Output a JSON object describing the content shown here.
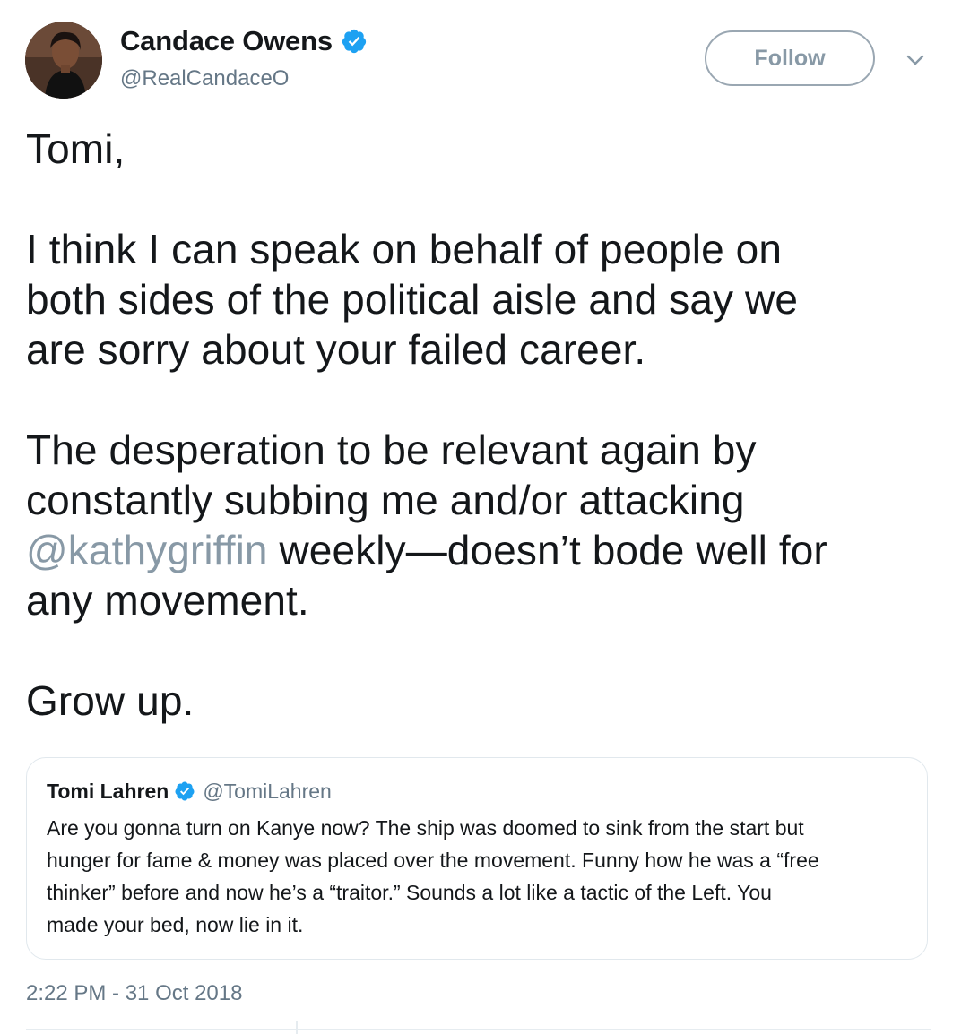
{
  "author": {
    "display_name": "Candace Owens",
    "handle": "@RealCandaceO",
    "verified": true,
    "avatar_icon": "profile-photo"
  },
  "actions": {
    "follow_label": "Follow",
    "caret_icon": "chevron-down-icon"
  },
  "tweet": {
    "lines": [
      "Tomi,",
      "",
      "I think I can speak on behalf of people on",
      "both sides of the political aisle and say we",
      "are sorry about your failed career.",
      "",
      "The desperation to be relevant again by",
      "constantly subbing me and/or attacking",
      "any movement.",
      "",
      "Grow up."
    ],
    "mention": "@kathygriffin",
    "mention_line_rest": " weekly—doesn’t bode well for"
  },
  "quoted_tweet": {
    "display_name": "Tomi Lahren",
    "handle": "@TomiLahren",
    "verified": true,
    "lines": [
      "Are you gonna turn on Kanye now? The ship was doomed to sink from the start but",
      "hunger for fame & money was placed over the movement. Funny how he was a “free",
      "thinker” before and now he’s a “traitor.” Sounds a lot like a tactic of the Left. You",
      "made your bed, now lie in it."
    ]
  },
  "timestamp": "2:22 PM - 31 Oct 2018",
  "colors": {
    "text": "#14171a",
    "secondary": "#657786",
    "mention": "#8899a6",
    "verified_blue": "#1da1f2",
    "border": "#e1e8ed"
  }
}
